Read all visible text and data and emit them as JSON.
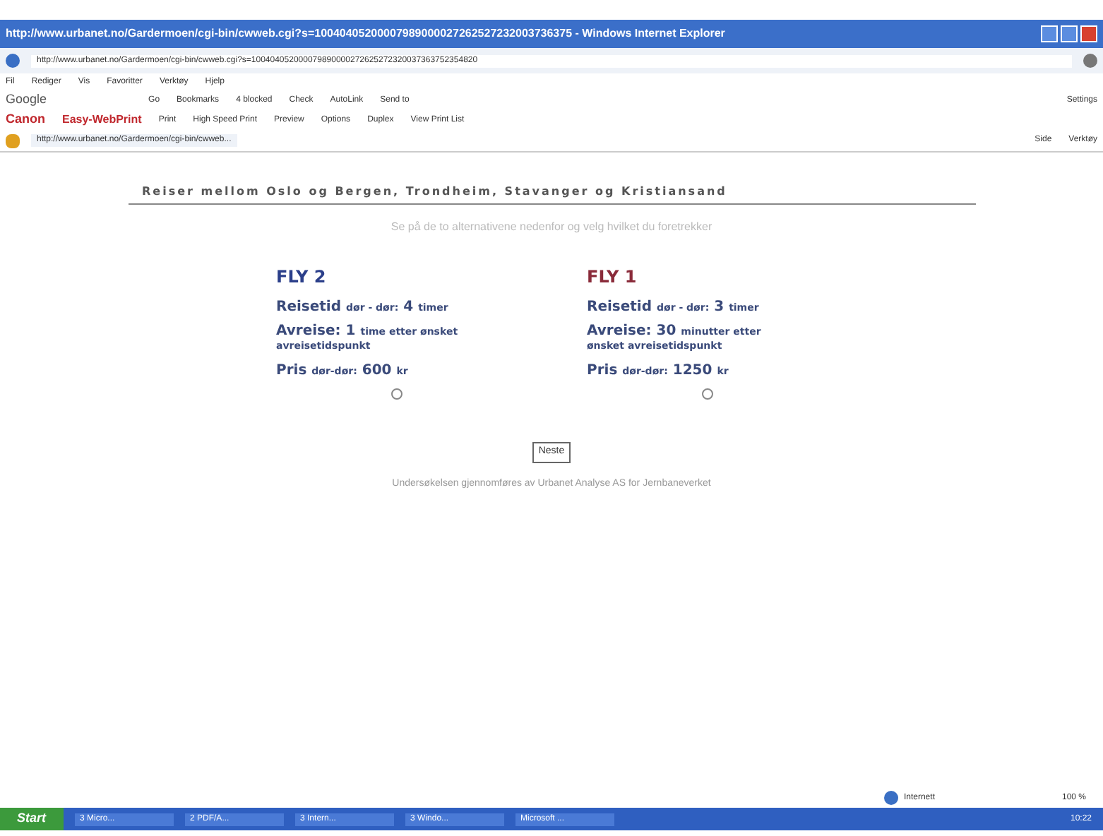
{
  "window": {
    "title": "http://www.urbanet.no/Gardermoen/cgi-bin/cwweb.cgi?s=10040405200007989000027262527232003736375 - Windows Internet Explorer"
  },
  "address_bar": {
    "value": "http://www.urbanet.no/Gardermoen/cgi-bin/cwweb.cgi?s=100404052000079890000272625272320037363752354820"
  },
  "menu": [
    "Fil",
    "Rediger",
    "Vis",
    "Favoritter",
    "Verktøy",
    "Hjelp"
  ],
  "google_toolbar": {
    "logo": "Google",
    "items": [
      "Go",
      "Bookmarks",
      "4 blocked",
      "Check",
      "AutoLink",
      "Send to"
    ],
    "settings": "Settings"
  },
  "canon_toolbar": {
    "brand": "Canon",
    "product": "Easy-WebPrint",
    "items": [
      "Print",
      "High Speed Print",
      "Preview",
      "Options",
      "Duplex",
      "View Print List"
    ]
  },
  "tab": {
    "label": "http://www.urbanet.no/Gardermoen/cgi-bin/cwweb..."
  },
  "command_bar": [
    "Side",
    "Verktøy"
  ],
  "page": {
    "heading": "Reiser mellom Oslo og Bergen, Trondheim, Stavanger og Kristiansand",
    "intro": "Se på de to alternativene nedenfor og velg hvilket du foretrekker",
    "options": [
      {
        "title": "FLY 2",
        "color": "#2b3f8a",
        "travel_label": "Reisetid",
        "travel_detail": "dør - dør:",
        "travel_value": "4",
        "travel_unit": "timer",
        "departure_label": "Avreise:",
        "departure_value": "1",
        "departure_unit": "time etter ønsket",
        "departure_rest": "avreisetidspunkt",
        "price_label": "Pris",
        "price_detail": "dør-dør:",
        "price_value": "600",
        "price_unit": "kr",
        "selected": false
      },
      {
        "title": "FLY 1",
        "color": "#8a2b3a",
        "travel_label": "Reisetid",
        "travel_detail": "dør - dør:",
        "travel_value": "3",
        "travel_unit": "timer",
        "departure_label": "Avreise:",
        "departure_value": "30",
        "departure_unit": "minutter etter",
        "departure_rest": "ønsket avreisetidspunkt",
        "price_label": "Pris",
        "price_detail": "dør-dør:",
        "price_value": "1250",
        "price_unit": "kr",
        "selected": false
      }
    ],
    "next_button": "Neste",
    "footer": "Undersøkelsen gjennomføres av Urbanet Analyse AS for Jernbaneverket"
  },
  "status_bar": {
    "zone": "Internett",
    "zoom": "100 %"
  },
  "taskbar": {
    "start": "Start",
    "items": [
      "3 Micro...",
      "2 PDF/A...",
      "3 Intern...",
      "3 Windo...",
      "Microsoft ..."
    ],
    "clock": "10:22"
  }
}
